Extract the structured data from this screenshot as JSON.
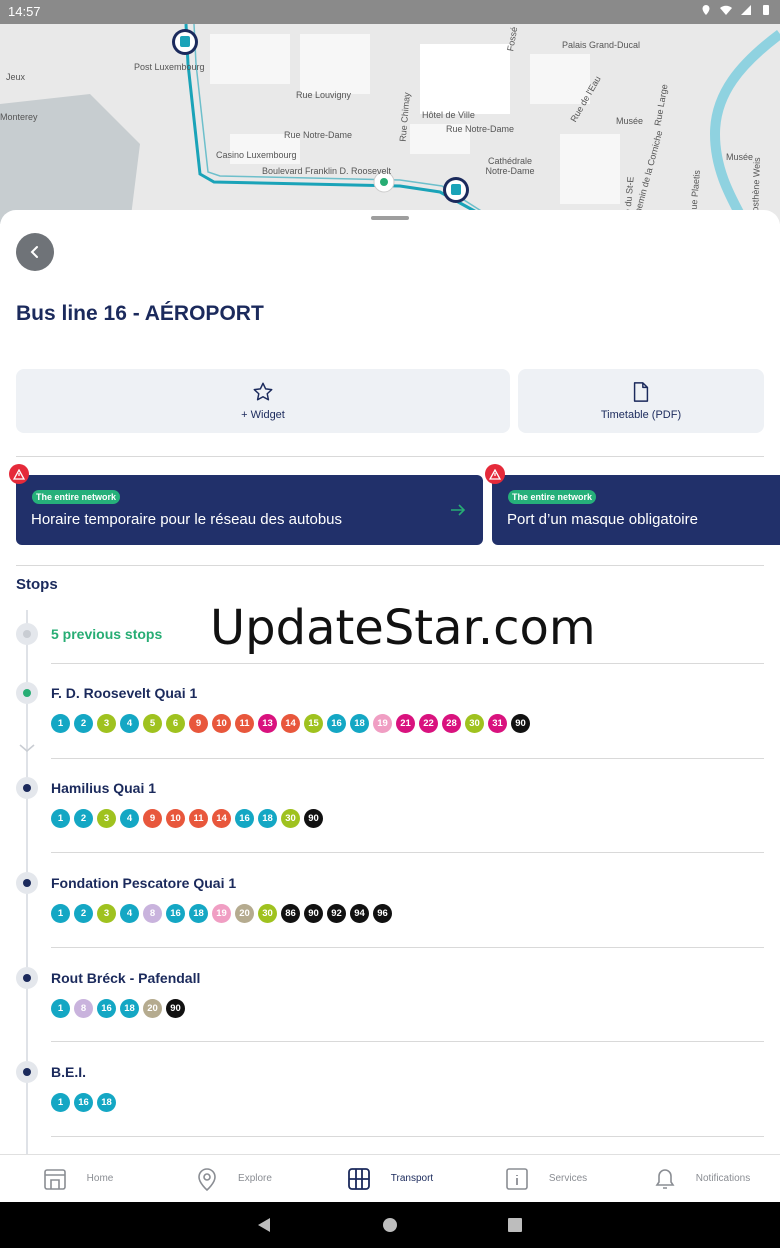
{
  "status_bar": {
    "time": "14:57"
  },
  "map": {
    "labels": [
      "Post Luxembourg",
      "Rue Louvigny",
      "Rue Notre-Dame",
      "Casino Luxembourg",
      "Hôtel de Ville",
      "Rue Notre-Dame",
      "Cathédrale Notre-Dame",
      "Palais Grand-Ducal",
      "Musée",
      "Musée",
      "Rue de l'Eau",
      "Rue Large",
      "Chemin de la Corniche",
      "Rue Chimay",
      "Boulevard Franklin D. Roosevelt",
      "Jeux",
      "Monterey",
      "Fossé",
      "Rue du St-E",
      "Rue Plaetis",
      "Rue Sosthène Weis"
    ]
  },
  "header": {
    "title": "Bus line 16 - AÉROPORT",
    "widget_label": "+ Widget",
    "timetable_label": "Timetable (PDF)"
  },
  "alerts": [
    {
      "badge": "The entire network",
      "text": "Horaire temporaire pour le réseau des autobus"
    },
    {
      "badge": "The entire network",
      "text": "Port d’un masque obligatoire"
    }
  ],
  "stops_title": "Stops",
  "previous_stops": "5 previous stops",
  "stops": [
    {
      "name": "F. D. Roosevelt Quai 1",
      "lines": [
        {
          "n": "1",
          "c": "#14a7c4"
        },
        {
          "n": "2",
          "c": "#14a7c4"
        },
        {
          "n": "3",
          "c": "#9fc21f"
        },
        {
          "n": "4",
          "c": "#14a7c4"
        },
        {
          "n": "5",
          "c": "#9fc21f"
        },
        {
          "n": "6",
          "c": "#9fc21f"
        },
        {
          "n": "9",
          "c": "#e8573c"
        },
        {
          "n": "10",
          "c": "#e8573c"
        },
        {
          "n": "11",
          "c": "#e8573c"
        },
        {
          "n": "13",
          "c": "#d9127e"
        },
        {
          "n": "14",
          "c": "#e8573c"
        },
        {
          "n": "15",
          "c": "#9fc21f"
        },
        {
          "n": "16",
          "c": "#14a7c4"
        },
        {
          "n": "18",
          "c": "#14a7c4"
        },
        {
          "n": "19",
          "c": "#f09ec3"
        },
        {
          "n": "21",
          "c": "#d9127e"
        },
        {
          "n": "22",
          "c": "#d9127e"
        },
        {
          "n": "28",
          "c": "#d9127e"
        },
        {
          "n": "30",
          "c": "#9fc21f"
        },
        {
          "n": "31",
          "c": "#d9127e"
        },
        {
          "n": "90",
          "c": "#111111"
        }
      ]
    },
    {
      "name": "Hamilius Quai 1",
      "lines": [
        {
          "n": "1",
          "c": "#14a7c4"
        },
        {
          "n": "2",
          "c": "#14a7c4"
        },
        {
          "n": "3",
          "c": "#9fc21f"
        },
        {
          "n": "4",
          "c": "#14a7c4"
        },
        {
          "n": "9",
          "c": "#e8573c"
        },
        {
          "n": "10",
          "c": "#e8573c"
        },
        {
          "n": "11",
          "c": "#e8573c"
        },
        {
          "n": "14",
          "c": "#e8573c"
        },
        {
          "n": "16",
          "c": "#14a7c4"
        },
        {
          "n": "18",
          "c": "#14a7c4"
        },
        {
          "n": "30",
          "c": "#9fc21f"
        },
        {
          "n": "90",
          "c": "#111111"
        }
      ]
    },
    {
      "name": "Fondation Pescatore Quai 1",
      "lines": [
        {
          "n": "1",
          "c": "#14a7c4"
        },
        {
          "n": "2",
          "c": "#14a7c4"
        },
        {
          "n": "3",
          "c": "#9fc21f"
        },
        {
          "n": "4",
          "c": "#14a7c4"
        },
        {
          "n": "8",
          "c": "#c9b3dd"
        },
        {
          "n": "16",
          "c": "#14a7c4"
        },
        {
          "n": "18",
          "c": "#14a7c4"
        },
        {
          "n": "19",
          "c": "#f09ec3"
        },
        {
          "n": "20",
          "c": "#b5ab8f"
        },
        {
          "n": "30",
          "c": "#9fc21f"
        },
        {
          "n": "86",
          "c": "#111111"
        },
        {
          "n": "90",
          "c": "#111111"
        },
        {
          "n": "92",
          "c": "#111111"
        },
        {
          "n": "94",
          "c": "#111111"
        },
        {
          "n": "96",
          "c": "#111111"
        }
      ]
    },
    {
      "name": "Rout Bréck - Pafendall",
      "lines": [
        {
          "n": "1",
          "c": "#14a7c4"
        },
        {
          "n": "8",
          "c": "#c9b3dd"
        },
        {
          "n": "16",
          "c": "#14a7c4"
        },
        {
          "n": "18",
          "c": "#14a7c4"
        },
        {
          "n": "20",
          "c": "#b5ab8f"
        },
        {
          "n": "90",
          "c": "#111111"
        }
      ]
    },
    {
      "name": "B.E.I.",
      "lines": [
        {
          "n": "1",
          "c": "#14a7c4"
        },
        {
          "n": "16",
          "c": "#14a7c4"
        },
        {
          "n": "18",
          "c": "#14a7c4"
        }
      ]
    }
  ],
  "watermark": "UpdateStar.com",
  "bottom_nav": [
    {
      "label": "Home",
      "icon": "home-icon"
    },
    {
      "label": "Explore",
      "icon": "location-pin-icon"
    },
    {
      "label": "Transport",
      "icon": "transport-icon"
    },
    {
      "label": "Services",
      "icon": "info-icon"
    },
    {
      "label": "Notifications",
      "icon": "bell-icon"
    }
  ],
  "colors": {
    "navy": "#1b2a5c",
    "green": "#27ad74",
    "alert_bg": "#21306a",
    "route": "#1aa3b8"
  }
}
